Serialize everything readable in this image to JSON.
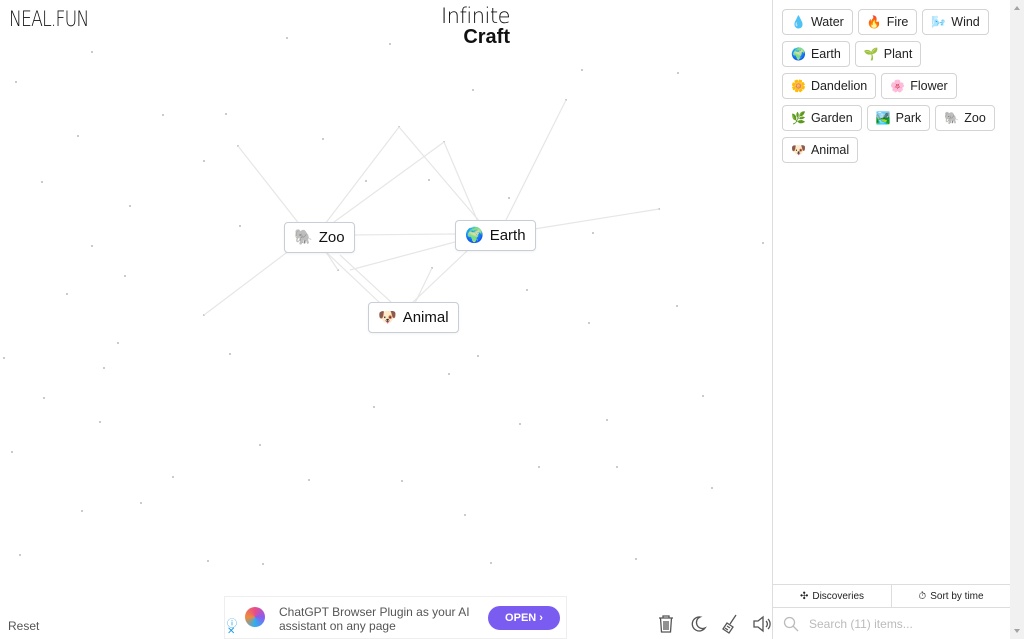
{
  "header": {
    "logo": "NEAL.FUN",
    "title_line1": "Infinite",
    "title_line2": "Craft"
  },
  "canvas": {
    "nodes": [
      {
        "label": "Zoo",
        "emoji": "🐘",
        "icon": "elephant-icon"
      },
      {
        "label": "Earth",
        "emoji": "🌍",
        "icon": "globe-icon"
      },
      {
        "label": "Animal",
        "emoji": "🐶",
        "icon": "dog-icon"
      }
    ],
    "reset_label": "Reset",
    "tools": [
      {
        "name": "trash-icon"
      },
      {
        "name": "moon-icon"
      },
      {
        "name": "broom-icon"
      },
      {
        "name": "sound-icon"
      }
    ]
  },
  "ad": {
    "text_line1": "ChatGPT Browser Plugin as your AI",
    "text_line2": "assistant on any page",
    "button": "OPEN ›",
    "info": "ⓘ",
    "close": "✕"
  },
  "sidebar": {
    "items": [
      {
        "label": "Water",
        "emoji": "💧"
      },
      {
        "label": "Fire",
        "emoji": "🔥"
      },
      {
        "label": "Wind",
        "emoji": "🌬️"
      },
      {
        "label": "Earth",
        "emoji": "🌍"
      },
      {
        "label": "Plant",
        "emoji": "🌱"
      },
      {
        "label": "Dandelion",
        "emoji": "🌼"
      },
      {
        "label": "Flower",
        "emoji": "🌸"
      },
      {
        "label": "Garden",
        "emoji": "🌿"
      },
      {
        "label": "Park",
        "emoji": "🏞️"
      },
      {
        "label": "Zoo",
        "emoji": "🐘"
      },
      {
        "label": "Animal",
        "emoji": "🐶"
      }
    ],
    "tabs": {
      "discoveries": "Discoveries",
      "sort": "Sort by time"
    },
    "search_placeholder": "Search (11) items..."
  }
}
